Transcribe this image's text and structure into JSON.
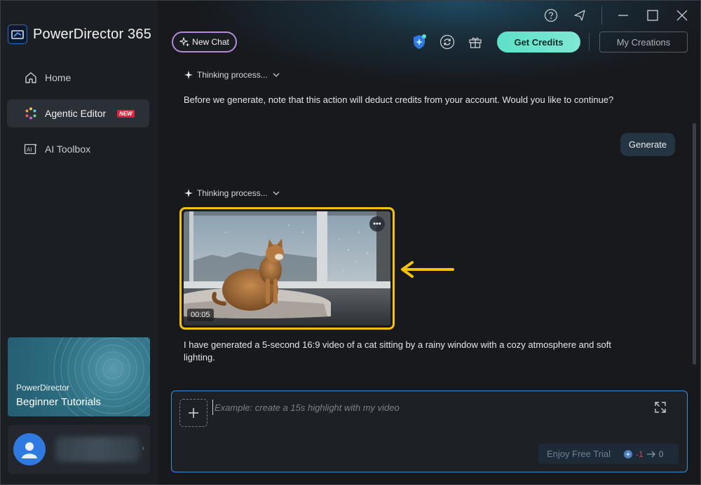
{
  "app": {
    "title": "PowerDirector 365"
  },
  "sidebar": {
    "items": [
      {
        "label": "Home",
        "icon": "home-icon"
      },
      {
        "label": "Agentic Editor",
        "icon": "sparkle-color-icon",
        "badge": "NEW"
      },
      {
        "label": "AI Toolbox",
        "icon": "ai-toolbox-icon"
      }
    ],
    "promo": {
      "small": "PowerDirector",
      "big": "Beginner Tutorials"
    }
  },
  "toolbar": {
    "new_chat": "New Chat",
    "get_credits": "Get Credits",
    "my_creations": "My Creations"
  },
  "chat": {
    "thinking_label": "Thinking process...",
    "messages": [
      {
        "role": "assistant",
        "text": "Before we generate, note that this action will deduct credits from your account. Would you like to continue?"
      },
      {
        "role": "user",
        "text": "Generate"
      },
      {
        "role": "assistant",
        "video_duration": "00:05",
        "text": "I have generated a 5-second 16:9 video of a cat sitting by a rainy window with a cozy atmosphere and soft lighting."
      }
    ]
  },
  "composer": {
    "placeholder": "Example: create a 15s highlight with my video",
    "free_trial_label": "Enjoy Free Trial",
    "credits_from": "-1",
    "credits_to": "0"
  },
  "colors": {
    "accent_mint": "#5ee0c8",
    "highlight_yellow": "#f4c20d",
    "new_badge": "#e0233a",
    "focus_blue": "#3f8fd8"
  }
}
